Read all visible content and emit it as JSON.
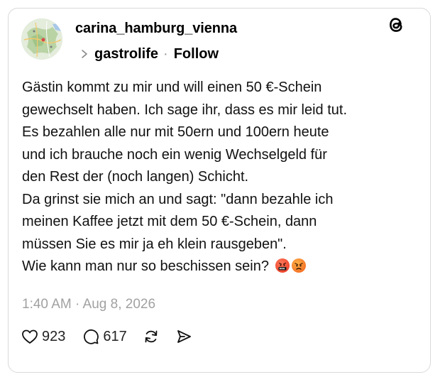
{
  "post": {
    "username": "carina_hamburg_vienna",
    "community": "gastrolife",
    "separator": "·",
    "follow_label": "Follow",
    "body_lines": [
      "Gästin kommt zu mir und will einen 50 €-Schein",
      "gewechselt haben. Ich sage ihr, dass es mir leid tut.",
      "Es bezahlen alle nur mit 50ern und 100ern heute",
      "und ich brauche noch ein wenig Wechselgeld für",
      "den Rest der (noch langen) Schicht.",
      "Da grinst sie mich an und sagt: \"dann bezahle ich",
      "meinen Kaffee jetzt mit dem 50 €-Schein, dann",
      "müssen Sie es mir ja eh klein rausgeben\".",
      "Wie kann man nur so beschissen sein?"
    ],
    "emojis": [
      "face-with-symbols-on-mouth-emoji",
      "angry-face-emoji"
    ],
    "timestamp": "1:40 AM · Aug 8, 2026",
    "actions": {
      "likes": "923",
      "replies": "617"
    }
  },
  "icons": {
    "logo": "threads-logo-icon",
    "chevron": "chevron-right-icon",
    "like": "heart-icon",
    "reply": "speech-bubble-icon",
    "repost": "repost-icon",
    "share": "send-icon"
  },
  "colors": {
    "text": "#000000",
    "muted": "#a1a1a1",
    "border": "#d9d9d9"
  }
}
